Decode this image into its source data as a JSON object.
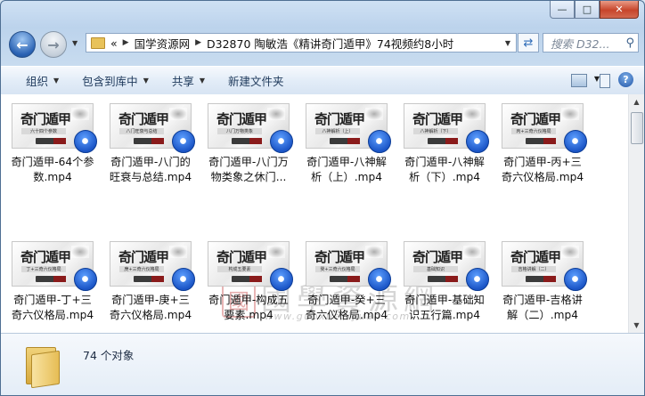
{
  "window": {
    "minimize_label": "—",
    "maximize_label": "□",
    "close_label": "✕"
  },
  "nav": {
    "back_icon": "back-arrow-icon",
    "forward_icon": "forward-arrow-icon",
    "breadcrumb_overflow": "«",
    "breadcrumb": [
      "国学资源网",
      "D32870 陶敏浩《精讲奇门遁甲》74视频约8小时"
    ],
    "search_placeholder": "搜索 D32...",
    "refresh_icon": "refresh-icon",
    "search_icon": "search-icon"
  },
  "commands": [
    "组织",
    "包含到库中",
    "共享",
    "新建文件夹"
  ],
  "files": [
    {
      "name": "奇门遁甲-64个参数.mp4",
      "line1": "奇门遁甲-64个参",
      "line2": "数.mp4",
      "thumb_title": "奇门遁甲",
      "thumb_sub": "六十四个参数"
    },
    {
      "name": "奇门遁甲-八门的旺衰与总结.mp4",
      "line1": "奇门遁甲-八门的",
      "line2": "旺衰与总结.mp4",
      "thumb_title": "奇门遁甲",
      "thumb_sub": "八门旺衰与总结"
    },
    {
      "name": "奇门遁甲-八门万物类象之休门....",
      "line1": "奇门遁甲-八门万",
      "line2": "物类象之休门...",
      "thumb_title": "奇门遁甲",
      "thumb_sub": "八门万物类象"
    },
    {
      "name": "奇门遁甲-八神解析（上）.mp4",
      "line1": "奇门遁甲-八神解",
      "line2": "析（上）.mp4",
      "thumb_title": "奇门遁甲",
      "thumb_sub": "八神解析（上）"
    },
    {
      "name": "奇门遁甲-八神解析（下）.mp4",
      "line1": "奇门遁甲-八神解",
      "line2": "析（下）.mp4",
      "thumb_title": "奇门遁甲",
      "thumb_sub": "八神解析（下）"
    },
    {
      "name": "奇门遁甲-丙+三奇六仪格局.mp4",
      "line1": "奇门遁甲-丙+三",
      "line2": "奇六仪格局.mp4",
      "thumb_title": "奇门遁甲",
      "thumb_sub": "丙+三奇六仪格局"
    },
    {
      "name": "奇门遁甲-丁+三奇六仪格局.mp4",
      "line1": "奇门遁甲-丁+三",
      "line2": "奇六仪格局.mp4",
      "thumb_title": "奇门遁甲",
      "thumb_sub": "丁+三奇六仪格局"
    },
    {
      "name": "奇门遁甲-庚+三奇六仪格局.mp4",
      "line1": "奇门遁甲-庚+三",
      "line2": "奇六仪格局.mp4",
      "thumb_title": "奇门遁甲",
      "thumb_sub": "庚+三奇六仪格局"
    },
    {
      "name": "奇门遁甲-构成五要素.mp4",
      "line1": "奇门遁甲-构成五",
      "line2": "要素.mp4",
      "thumb_title": "奇门遁甲",
      "thumb_sub": "构成五要素"
    },
    {
      "name": "奇门遁甲-癸+三奇六仪格局.mp4",
      "line1": "奇门遁甲-癸+三",
      "line2": "奇六仪格局.mp4",
      "thumb_title": "奇门遁甲",
      "thumb_sub": "癸+三奇六仪格局"
    },
    {
      "name": "奇门遁甲-基础知识五行篇.mp4",
      "line1": "奇门遁甲-基础知",
      "line2": "识五行篇.mp4",
      "thumb_title": "奇门遁甲",
      "thumb_sub": "基础知识"
    },
    {
      "name": "奇门遁甲-吉格讲解（二）.mp4",
      "line1": "奇门遁甲-吉格讲",
      "line2": "解（二）.mp4",
      "thumb_title": "奇门遁甲",
      "thumb_sub": "吉格讲解（二）"
    }
  ],
  "watermark": {
    "seal": "國",
    "text": "國學資源網",
    "url": "www.guoxueziyuan.com"
  },
  "status": {
    "item_count": "74 个对象"
  },
  "colors": {
    "accent": "#2a62b3",
    "close": "#c7452b",
    "folder": "#e6bd55"
  }
}
